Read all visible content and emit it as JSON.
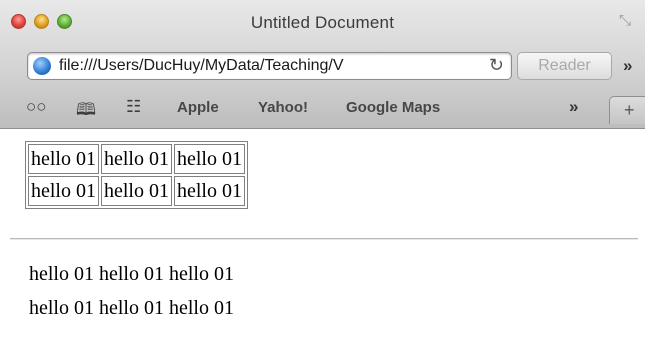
{
  "window": {
    "title": "Untitled Document"
  },
  "toolbar": {
    "url": "file:///Users/DucHuy/MyData/Teaching/V",
    "reader_label": "Reader",
    "overflow_glyph": "»"
  },
  "bookmarks": {
    "items": [
      "Apple",
      "Yahoo!",
      "Google Maps"
    ],
    "overflow_glyph": "»",
    "new_tab_glyph": "+"
  },
  "icons": {
    "reading_list": "reading-list-icon",
    "bookmarks_book": "bookmarks-book-icon",
    "top_sites": "topsites-grid-icon",
    "site": "globe-icon",
    "reload": "reload-icon"
  },
  "content": {
    "table": {
      "rows": [
        [
          "hello 01",
          "hello 01",
          "hello 01"
        ],
        [
          "hello 01",
          "hello 01",
          "hello 01"
        ]
      ]
    },
    "lines": [
      "hello 01 hello 01 hello 01",
      "hello 01 hello 01 hello 01"
    ]
  }
}
